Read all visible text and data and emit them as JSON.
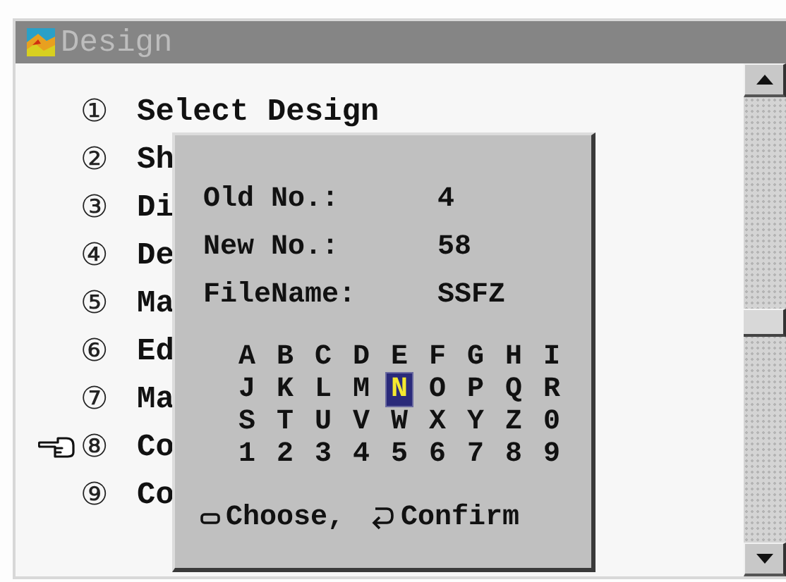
{
  "window": {
    "title": "Design"
  },
  "menu": [
    {
      "marker": "①",
      "label": "Select Design",
      "selected": false
    },
    {
      "marker": "②",
      "label": "Sh",
      "selected": false
    },
    {
      "marker": "③",
      "label": "Di",
      "selected": false
    },
    {
      "marker": "④",
      "label": "De",
      "selected": false
    },
    {
      "marker": "⑤",
      "label": "Ma",
      "selected": false
    },
    {
      "marker": "⑥",
      "label": "Ed",
      "selected": false
    },
    {
      "marker": "⑦",
      "label": "Ma",
      "selected": false
    },
    {
      "marker": "⑧",
      "label": "Co",
      "selected": true
    },
    {
      "marker": "⑨",
      "label": "Co",
      "selected": false
    }
  ],
  "dialog": {
    "fields": [
      {
        "label": "Old No.:",
        "value": "4"
      },
      {
        "label": "New No.:",
        "value": "58"
      },
      {
        "label": "FileName:",
        "value": "SSFZ"
      }
    ],
    "keys": [
      {
        "label": "A",
        "selected": false
      },
      {
        "label": "B",
        "selected": false
      },
      {
        "label": "C",
        "selected": false
      },
      {
        "label": "D",
        "selected": false
      },
      {
        "label": "E",
        "selected": false
      },
      {
        "label": "F",
        "selected": false
      },
      {
        "label": "G",
        "selected": false
      },
      {
        "label": "H",
        "selected": false
      },
      {
        "label": "I",
        "selected": false
      },
      {
        "label": "J",
        "selected": false
      },
      {
        "label": "K",
        "selected": false
      },
      {
        "label": "L",
        "selected": false
      },
      {
        "label": "M",
        "selected": false
      },
      {
        "label": "N",
        "selected": true
      },
      {
        "label": "O",
        "selected": false
      },
      {
        "label": "P",
        "selected": false
      },
      {
        "label": "Q",
        "selected": false
      },
      {
        "label": "R",
        "selected": false
      },
      {
        "label": "S",
        "selected": false
      },
      {
        "label": "T",
        "selected": false
      },
      {
        "label": "U",
        "selected": false
      },
      {
        "label": "V",
        "selected": false
      },
      {
        "label": "W",
        "selected": false
      },
      {
        "label": "X",
        "selected": false
      },
      {
        "label": "Y",
        "selected": false
      },
      {
        "label": "Z",
        "selected": false
      },
      {
        "label": "0",
        "selected": false
      },
      {
        "label": "1",
        "selected": false
      },
      {
        "label": "2",
        "selected": false
      },
      {
        "label": "3",
        "selected": false
      },
      {
        "label": "4",
        "selected": false
      },
      {
        "label": "5",
        "selected": false
      },
      {
        "label": "6",
        "selected": false
      },
      {
        "label": "7",
        "selected": false
      },
      {
        "label": "8",
        "selected": false
      },
      {
        "label": "9",
        "selected": false
      }
    ],
    "hint_choose": "Choose,",
    "hint_confirm": "Confirm"
  }
}
